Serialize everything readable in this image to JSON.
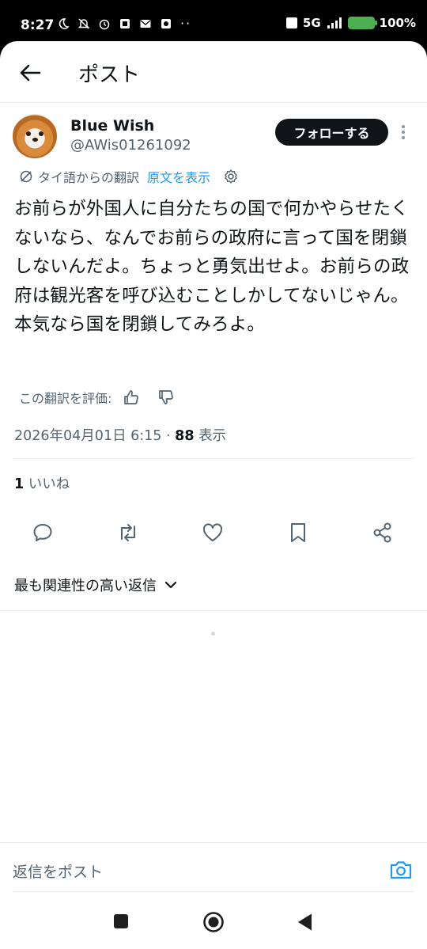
{
  "status_bar": {
    "time": "8:27",
    "network": "5G",
    "battery": "100%"
  },
  "header": {
    "title": "ポスト"
  },
  "author": {
    "name": "Blue Wish",
    "handle": "@AWis01261092",
    "follow_label": "フォローする"
  },
  "translation": {
    "source_note": "タイ語からの翻訳",
    "show_original": "原文を表示"
  },
  "post": {
    "text": "お前らが外国人に自分たちの国で何かやらせたくないなら、なんでお前らの政府に言って国を閉鎖しないんだよ。ちょっと勇気出せよ。お前らの政府は観光客を呼び込むことしかしてないじゃん。本気なら国を閉鎖してみろよ。"
  },
  "rating": {
    "label": "この翻訳を評価:"
  },
  "meta": {
    "timestamp": "2026年04月01日 6:15",
    "separator": " · ",
    "views_count": "88",
    "views_label": "表示"
  },
  "likes": {
    "count": "1",
    "label": "いいね"
  },
  "replies": {
    "sort_label": "最も関連性の高い返信"
  },
  "reply_box": {
    "placeholder": "返信をポスト"
  },
  "colors": {
    "accent": "#1d9bf0",
    "text_primary": "#0f1419",
    "text_secondary": "#536471",
    "follow_button_bg": "#0f1419",
    "battery": "#4caf50"
  }
}
